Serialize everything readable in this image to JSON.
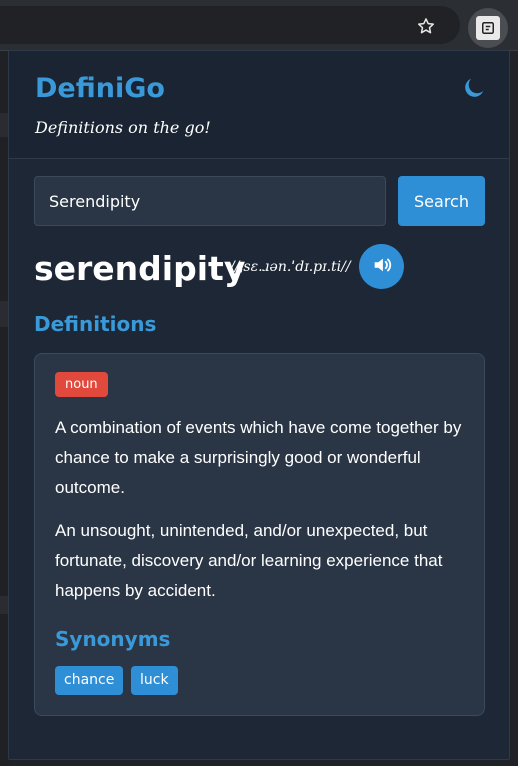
{
  "app": {
    "title": "DefiniGo",
    "tagline": "Definitions on the go!"
  },
  "search": {
    "value": "Serendipity",
    "button_label": "Search"
  },
  "entry": {
    "word": "serendipity",
    "phonetic": "//ˌsɛ.ɹən.ˈdɪ.pɪ.ti//",
    "section_heading": "Definitions",
    "part_of_speech": "noun",
    "definitions": [
      "A combination of events which have come together by chance to make a surprisingly good or wonderful outcome.",
      "An unsought, unintended, and/or unexpected, but fortunate, discovery and/or learning experience that happens by accident."
    ],
    "synonyms_heading": "Synonyms",
    "synonyms": [
      "chance",
      "luck"
    ]
  },
  "icons": {
    "theme_toggle": "moon-icon",
    "audio": "speaker-icon",
    "bookmark": "star-icon",
    "extension": "definigo-extension-icon"
  },
  "colors": {
    "accent": "#3a9ad9",
    "button": "#2f8fd6",
    "badge_noun": "#e0493c",
    "popup_bg": "#1d2735",
    "card_bg": "#2a3646"
  }
}
